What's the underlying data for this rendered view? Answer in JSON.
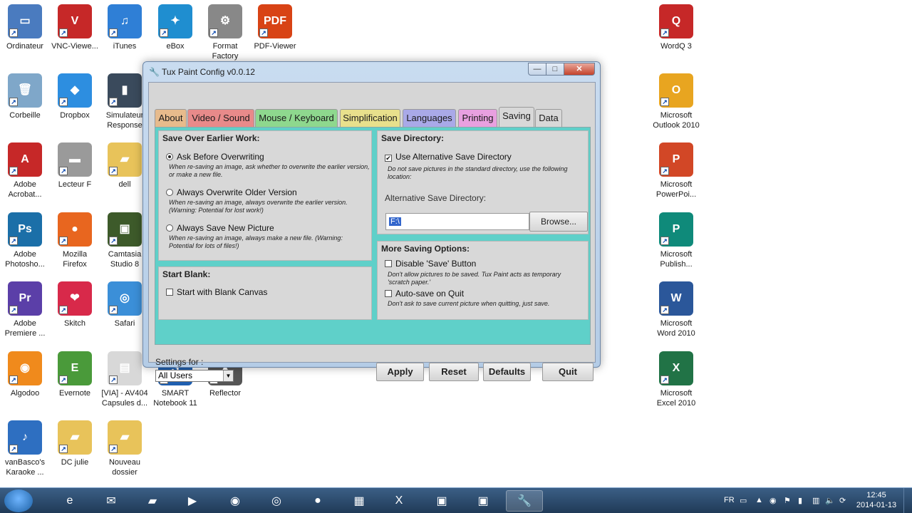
{
  "desktop": {
    "icons": [
      {
        "label": "Ordinateur",
        "color": "#4a7bbf",
        "glyph": "▭",
        "name": "computer-icon"
      },
      {
        "label": "VNC-Viewe...",
        "color": "#c62828",
        "glyph": "V",
        "name": "vnc-icon"
      },
      {
        "label": "iTunes",
        "color": "#2f7fd6",
        "glyph": "♫",
        "name": "itunes-icon"
      },
      {
        "label": "eBox",
        "color": "#1f8ed0",
        "glyph": "✦",
        "name": "ebox-icon"
      },
      {
        "label": "Format Factory",
        "color": "#888888",
        "glyph": "⚙",
        "name": "format-factory-icon"
      },
      {
        "label": "PDF-Viewer",
        "color": "#d84315",
        "glyph": "PDF",
        "name": "pdf-viewer-icon"
      },
      {
        "label": "Corbeille",
        "color": "#7fa7c9",
        "glyph": "🗑",
        "name": "recycle-bin-icon"
      },
      {
        "label": "Dropbox",
        "color": "#2d8ee0",
        "glyph": "◆",
        "name": "dropbox-icon"
      },
      {
        "label": "Simulateur Response",
        "color": "#3a4a5c",
        "glyph": "▮",
        "name": "simulator-icon"
      },
      {
        "label": "Adobe Acrobat...",
        "color": "#c62828",
        "glyph": "A",
        "name": "acrobat-icon"
      },
      {
        "label": "Lecteur F",
        "color": "#9a9a9a",
        "glyph": "▬",
        "name": "drive-icon"
      },
      {
        "label": "dell",
        "color": "#e8c35a",
        "glyph": "▰",
        "name": "folder-icon"
      },
      {
        "label": "Adobe Photosho...",
        "color": "#1b6fa8",
        "glyph": "Ps",
        "name": "photoshop-icon"
      },
      {
        "label": "Mozilla Firefox",
        "color": "#e8661f",
        "glyph": "●",
        "name": "firefox-icon"
      },
      {
        "label": "Camtasia Studio 8",
        "color": "#3d5a2a",
        "glyph": "▣",
        "name": "camtasia-icon"
      },
      {
        "label": "Adobe Premiere ...",
        "color": "#5b3fa8",
        "glyph": "Pr",
        "name": "premiere-icon"
      },
      {
        "label": "Skitch",
        "color": "#d8294a",
        "glyph": "❤",
        "name": "skitch-icon"
      },
      {
        "label": "Safari",
        "color": "#3b8fd8",
        "glyph": "◎",
        "name": "safari-icon"
      },
      {
        "label": "Algodoo",
        "color": "#f08a1c",
        "glyph": "◉",
        "name": "algodoo-icon"
      },
      {
        "label": "Evernote",
        "color": "#4a9a3a",
        "glyph": "E",
        "name": "evernote-icon"
      },
      {
        "label": "[VIA] - AV404 Capsules d...",
        "color": "#d8d8d8",
        "glyph": "▤",
        "name": "pdf-file-icon"
      },
      {
        "label": "SMART Notebook 11",
        "color": "#1f5fb0",
        "glyph": "S",
        "name": "smart-notebook-icon"
      },
      {
        "label": "Reflector",
        "color": "#555555",
        "glyph": "▲",
        "name": "reflector-icon"
      },
      {
        "label": "vanBasco's Karaoke ...",
        "color": "#2e6fc1",
        "glyph": "♪",
        "name": "vanbasco-icon"
      },
      {
        "label": "DC julie",
        "color": "#e8c35a",
        "glyph": "▰",
        "name": "folder-icon"
      },
      {
        "label": "Nouveau dossier",
        "color": "#e8c35a",
        "glyph": "▰",
        "name": "folder-icon"
      },
      {
        "label": "WordQ 3",
        "color": "#c62828",
        "glyph": "Q",
        "name": "wordq-icon"
      },
      {
        "label": "Microsoft Outlook 2010",
        "color": "#e8a520",
        "glyph": "O",
        "name": "outlook-icon"
      },
      {
        "label": "Microsoft PowerPoi...",
        "color": "#d24726",
        "glyph": "P",
        "name": "powerpoint-icon"
      },
      {
        "label": "Microsoft Publish...",
        "color": "#0f8a7a",
        "glyph": "P",
        "name": "publisher-icon"
      },
      {
        "label": "Microsoft Word 2010",
        "color": "#2b579a",
        "glyph": "W",
        "name": "word-icon"
      },
      {
        "label": "Microsoft Excel 2010",
        "color": "#217346",
        "glyph": "X",
        "name": "excel-icon"
      }
    ]
  },
  "window": {
    "title": "Tux Paint Config v0.0.12",
    "min": "—",
    "max": "□",
    "close": "✕",
    "tabs": [
      {
        "label": "About",
        "color": "#e7bb8c"
      },
      {
        "label": "Video / Sound",
        "color": "#e88a8a"
      },
      {
        "label": "Mouse / Keyboard",
        "color": "#8ed88e"
      },
      {
        "label": "Simplification",
        "color": "#e8e08c"
      },
      {
        "label": "Languages",
        "color": "#a9a9e8"
      },
      {
        "label": "Printing",
        "color": "#e8a0e0"
      },
      {
        "label": "Saving",
        "color": "#d8d8d8"
      },
      {
        "label": "Data",
        "color": "#d8d8d8"
      }
    ],
    "save_over": {
      "title": "Save Over Earlier Work:",
      "options": [
        {
          "label": "Ask Before Overwriting",
          "checked": true,
          "desc": "When re-saving an image, ask whether to overwrite the earlier version, or make a new file."
        },
        {
          "label": "Always Overwrite Older Version",
          "checked": false,
          "desc": "When re-saving an image, always overwrite the earlier version. (Warning: Potential for lost work!)"
        },
        {
          "label": "Always Save New Picture",
          "checked": false,
          "desc": "When re-saving an image, always make a new file. (Warning: Potential for lots of files!)"
        }
      ]
    },
    "start_blank": {
      "title": "Start Blank:",
      "option": "Start with Blank Canvas"
    },
    "save_dir": {
      "title": "Save Directory:",
      "use_alt": "Use Alternative Save Directory",
      "use_alt_desc": "Do not save pictures in the standard directory, use the following location:",
      "alt_label": "Alternative Save Directory:",
      "alt_value": "F:\\",
      "browse": "Browse..."
    },
    "more_saving": {
      "title": "More Saving Options:",
      "disable_save": "Disable 'Save' Button",
      "disable_save_desc": "Don't allow pictures to be saved. Tux Paint acts as temporary 'scratch paper.'",
      "autosave": "Auto-save on Quit",
      "autosave_desc": "Don't ask to save current picture when quitting, just save."
    },
    "settings_for": "Settings for :",
    "settings_value": "All Users",
    "buttons": {
      "apply": "Apply",
      "reset": "Reset",
      "defaults": "Defaults",
      "quit": "Quit"
    }
  },
  "taskbar": {
    "tray_lang": "FR",
    "time": "12:45",
    "date": "2014-01-13"
  }
}
